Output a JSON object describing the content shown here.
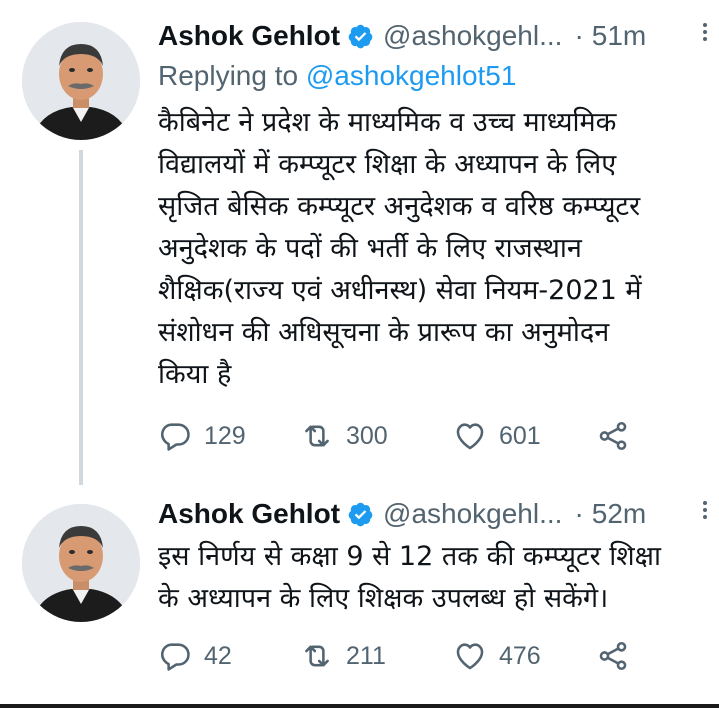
{
  "tweets": [
    {
      "name": "Ashok Gehlot",
      "handle": "@ashokgehl...",
      "dot": "·",
      "time": "51m",
      "replying_prefix": "Replying to",
      "replying_to": "@ashokgehlot51",
      "text": "कैबिनेट ने प्रदेश के माध्यमिक व उच्च माध्यमिक\nविद्यालयों में कम्प्यूटर शिक्षा के अध्यापन के लिए\nसृजित बेसिक कम्प्यूटर अनुदेशक व वरिष्ठ कम्प्यूटर\nअनुदेशक के पदों की भर्ती के लिए राजस्थान\nशैक्षिक(राज्य एवं अधीनस्थ) सेवा नियम-2021 में\nसंशोधन की अधिसूचना के प्रारूप का अनुमोदन\nकिया है",
      "replies": "129",
      "retweets": "300",
      "likes": "601"
    },
    {
      "name": "Ashok Gehlot",
      "handle": "@ashokgehl...",
      "dot": "·",
      "time": "52m",
      "text": "इस निर्णय से कक्षा 9 से 12 तक की कम्प्यूटर शिक्षा\nके अध्यापन के लिए शिक्षक उपलब्ध हो सकेंगे।",
      "replies": "42",
      "retweets": "211",
      "likes": "476"
    }
  ],
  "colors": {
    "text": "#0f1419",
    "secondary": "#536471",
    "link": "#1d9bf0",
    "verified": "#1d9bf0",
    "thread_line": "#cfd9de"
  },
  "icons": [
    "verified-badge-icon",
    "more-icon",
    "reply-icon",
    "retweet-icon",
    "like-icon",
    "share-icon"
  ]
}
